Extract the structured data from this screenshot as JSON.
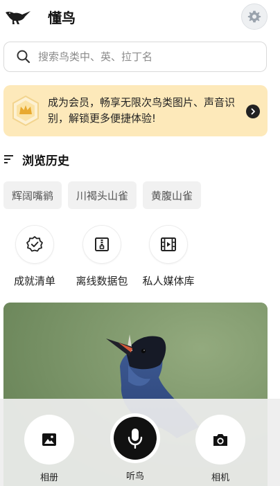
{
  "app": {
    "title": "懂鸟"
  },
  "search": {
    "placeholder": "搜索鸟类中、英、拉丁名"
  },
  "vip_banner": {
    "text": "成为会员，畅享无限次鸟类图片、声音识别，解锁更多便捷体验!"
  },
  "history": {
    "title": "浏览历史",
    "items": [
      "辉阔嘴鹟",
      "川褐头山雀",
      "黄腹山雀"
    ]
  },
  "tools": [
    {
      "label": "成就清单",
      "icon": "achievement-badge-icon"
    },
    {
      "label": "离线数据包",
      "icon": "offline-package-icon"
    },
    {
      "label": "私人媒体库",
      "icon": "media-library-icon"
    }
  ],
  "bottom_bar": {
    "album_label": "相册",
    "listen_label": "听鸟",
    "camera_label": "相机"
  },
  "colors": {
    "vip_banner_bg": "#fde9ba",
    "accent_dark": "#111111",
    "chip_bg": "#f1f1f1"
  }
}
